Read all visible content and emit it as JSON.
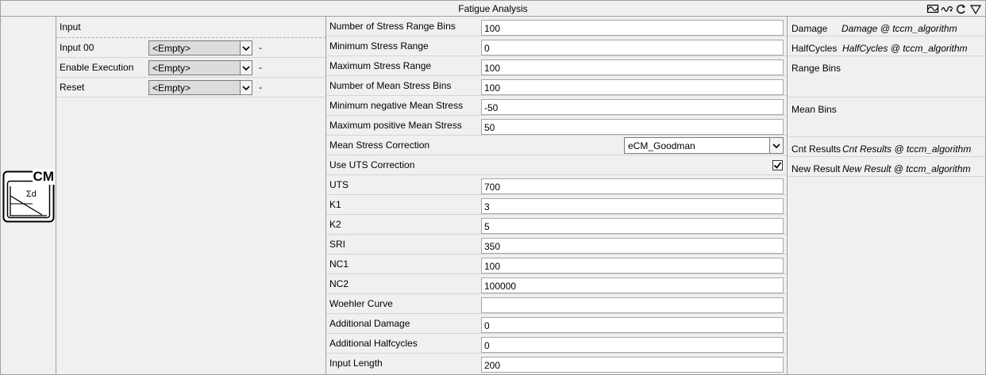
{
  "window": {
    "title": "Fatigue Analysis"
  },
  "title_icons": [
    "waveform-icon",
    "wave-loop-icon",
    "redo-arrow-icon",
    "collapse-triangle-icon"
  ],
  "logo": {
    "text": "CM",
    "symbol": "Σd"
  },
  "inputs": {
    "header": "Input",
    "rows": [
      {
        "label": "Input 00",
        "value": "<Empty>",
        "dash": "-"
      },
      {
        "label": "Enable Execution",
        "value": "<Empty>",
        "dash": "-"
      },
      {
        "label": "Reset",
        "value": "<Empty>",
        "dash": "-"
      }
    ]
  },
  "params": [
    {
      "label": "Number of Stress Range Bins",
      "value": "100"
    },
    {
      "label": "Minimum Stress Range",
      "value": "0"
    },
    {
      "label": "Maximum Stress Range",
      "value": "100"
    },
    {
      "label": "Number of Mean Stress Bins",
      "value": "100"
    },
    {
      "label": "Minimum negative Mean Stress",
      "value": "-50"
    },
    {
      "label": "Maximum positive Mean Stress",
      "value": "50"
    },
    {
      "label": "Mean Stress Correction",
      "value": "eCM_Goodman"
    },
    {
      "label": "Use UTS Correction",
      "checked": true
    },
    {
      "label": "UTS",
      "value": "700"
    },
    {
      "label": "K1",
      "value": "3"
    },
    {
      "label": "K2",
      "value": "5"
    },
    {
      "label": "SRI",
      "value": "350"
    },
    {
      "label": "NC1",
      "value": "100"
    },
    {
      "label": "NC2",
      "value": "100000"
    },
    {
      "label": "Woehler Curve",
      "value": ""
    },
    {
      "label": "Additional Damage",
      "value": "0"
    },
    {
      "label": "Additional Halfcycles",
      "value": "0"
    },
    {
      "label": "Input Length",
      "value": "200"
    }
  ],
  "outputs": [
    {
      "name": "Damage",
      "value": "Damage @ tccm_algorithm"
    },
    {
      "name": "HalfCycles",
      "value": "HalfCycles @ tccm_algorithm"
    },
    {
      "name": "Range Bins",
      "value": ""
    },
    {
      "name": "Mean Bins",
      "value": ""
    },
    {
      "name": "Cnt Results",
      "value": "Cnt Results @ tccm_algorithm"
    },
    {
      "name": "New Result",
      "value": "New Result @ tccm_algorithm"
    }
  ]
}
